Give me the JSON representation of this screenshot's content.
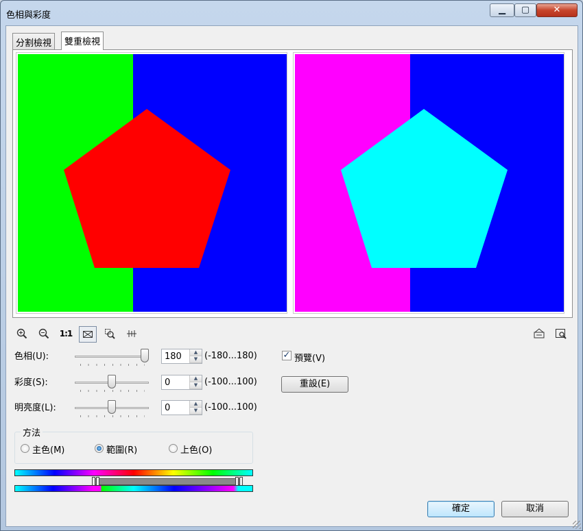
{
  "window": {
    "title": "色相與彩度",
    "minimize": "▁",
    "maximize": "▢",
    "close": "✕"
  },
  "tabs": [
    {
      "label": "分割檢視"
    },
    {
      "label": "雙重檢視"
    }
  ],
  "active_tab": 1,
  "preview": {
    "before": {
      "left_color": "#00ff00",
      "right_color": "#0000ff",
      "shape_color": "#ff0000"
    },
    "after": {
      "left_color": "#ff00ff",
      "right_color": "#0000ff",
      "shape_color": "#00ffff"
    }
  },
  "toolbar": {
    "zoom_in_icon": "zoom-in-icon",
    "zoom_out_icon": "zoom-out-icon",
    "actual_size_label": "1:1",
    "fit_icon": "fit-window-icon",
    "zoom_tool_icon": "zoom-tool-icon",
    "pan_icon": "pan-icon",
    "right_icons": [
      "layout-icon",
      "preview-window-icon"
    ]
  },
  "controls": {
    "hue": {
      "label": "色相(U):",
      "value": "180",
      "range": "(-180...180)",
      "level": 1.0
    },
    "saturation": {
      "label": "彩度(S):",
      "value": "0",
      "range": "(-100...100)",
      "level": 0.5
    },
    "lightness": {
      "label": "明亮度(L):",
      "value": "0",
      "range": "(-100...100)",
      "level": 0.5
    }
  },
  "preview_checkbox": {
    "label": "預覽(V)",
    "checked": true
  },
  "reset_button": "重設(E)",
  "method": {
    "legend": "方法",
    "options": [
      {
        "label": "主色(M)",
        "selected": false
      },
      {
        "label": "範圍(R)",
        "selected": true
      },
      {
        "label": "上色(O)",
        "selected": false
      }
    ]
  },
  "buttons": {
    "ok": "確定",
    "cancel": "取消"
  }
}
